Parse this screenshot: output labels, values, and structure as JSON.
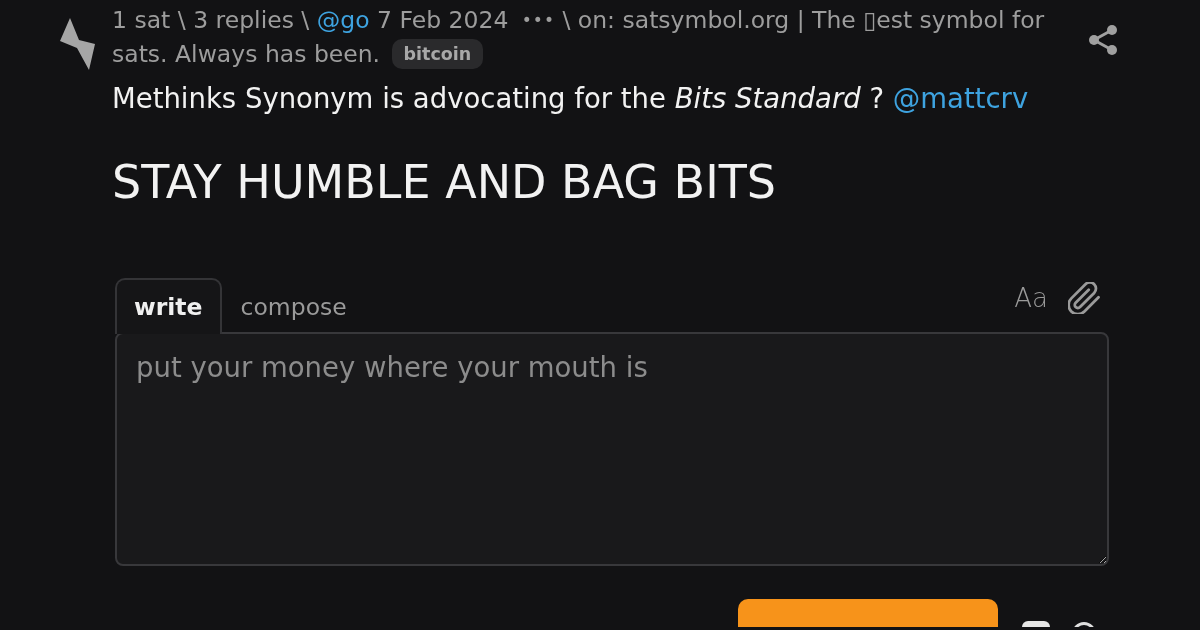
{
  "post": {
    "meta_lines": [
      [
        {
          "kind": "text",
          "text": "1 sat"
        },
        {
          "kind": "separator",
          "text": "\\"
        },
        {
          "kind": "text",
          "text": "3 replies"
        },
        {
          "kind": "separator",
          "text": "\\"
        },
        {
          "kind": "mention",
          "text": "@go"
        },
        {
          "kind": "text",
          "text": "7 Feb 2024"
        },
        {
          "kind": "menu",
          "text": "•••"
        },
        {
          "kind": "separator",
          "text": "\\"
        },
        {
          "kind": "text",
          "text": "on: satsymbol.org | The ▯est symbol for"
        }
      ],
      [
        {
          "kind": "text",
          "text": "sats. Always has been."
        },
        {
          "kind": "badge",
          "text": "bitcoin"
        }
      ]
    ],
    "body": {
      "text": "Methinks Synonym is advocating for the *Bits Standard* ?",
      "mention": "@mattcrv"
    },
    "heading": "STAY HUMBLE AND BAG BITS"
  },
  "reply_form": {
    "tabs": [
      {
        "label": "write",
        "selected": true
      },
      {
        "label": "compose",
        "selected": false
      }
    ],
    "format_toggle": "Aa",
    "placeholder": "put your money where your mouth is"
  }
}
